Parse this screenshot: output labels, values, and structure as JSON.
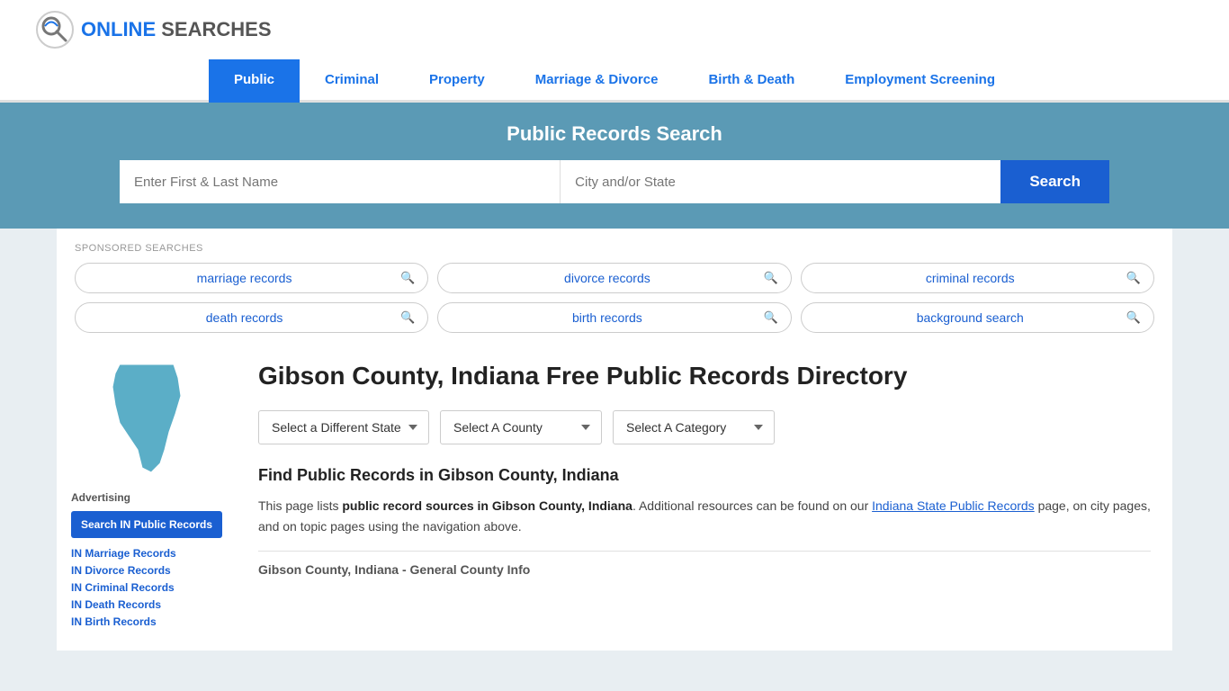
{
  "header": {
    "logo_text_online": "ONLINE",
    "logo_text_searches": "SEARCHES"
  },
  "nav": {
    "items": [
      {
        "label": "Public",
        "active": true
      },
      {
        "label": "Criminal",
        "active": false
      },
      {
        "label": "Property",
        "active": false
      },
      {
        "label": "Marriage & Divorce",
        "active": false
      },
      {
        "label": "Birth & Death",
        "active": false
      },
      {
        "label": "Employment Screening",
        "active": false
      }
    ]
  },
  "search_banner": {
    "title": "Public Records Search",
    "name_placeholder": "Enter First & Last Name",
    "location_placeholder": "City and/or State",
    "button_label": "Search"
  },
  "sponsored": {
    "label": "SPONSORED SEARCHES",
    "items": [
      {
        "text": "marriage records"
      },
      {
        "text": "divorce records"
      },
      {
        "text": "criminal records"
      },
      {
        "text": "death records"
      },
      {
        "text": "birth records"
      },
      {
        "text": "background search"
      }
    ]
  },
  "sidebar": {
    "advertising_label": "Advertising",
    "button_label": "Search IN Public Records",
    "links": [
      {
        "text": "IN Marriage Records"
      },
      {
        "text": "IN Divorce Records"
      },
      {
        "text": "IN Criminal Records"
      },
      {
        "text": "IN Death Records"
      },
      {
        "text": "IN Birth Records"
      }
    ]
  },
  "main": {
    "page_title": "Gibson County, Indiana Free Public Records Directory",
    "dropdowns": {
      "state_label": "Select a Different State",
      "county_label": "Select A County",
      "category_label": "Select A Category"
    },
    "section_heading": "Find Public Records in Gibson County, Indiana",
    "description_part1": "This page lists ",
    "description_bold": "public record sources in Gibson County, Indiana",
    "description_part2": ". Additional resources can be found on our ",
    "description_link_text": "Indiana State Public Records",
    "description_part3": " page, on city pages, and on topic pages using the navigation above.",
    "subsection_heading": "Gibson County, Indiana - General County Info"
  }
}
